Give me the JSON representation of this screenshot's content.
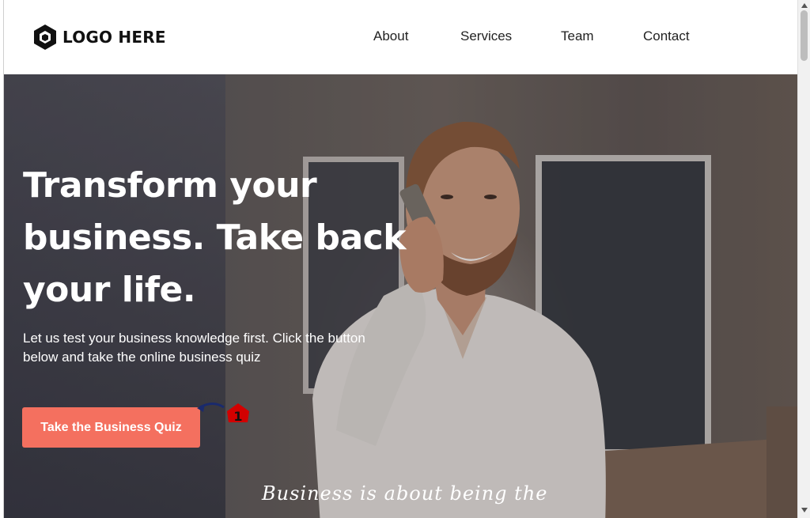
{
  "header": {
    "logo_text": "LOGO HERE",
    "logo_icon": "hexagon-cube-icon",
    "nav": [
      {
        "label": "About"
      },
      {
        "label": "Services"
      },
      {
        "label": "Team"
      },
      {
        "label": "Contact"
      }
    ]
  },
  "hero": {
    "title_lines": [
      "Transform your",
      "business. Take back",
      "your life."
    ],
    "subtitle_lines": [
      "Let us test your business knowledge first. Click the button",
      "below and take the online business quiz"
    ],
    "cta_label": "Take the Business Quiz",
    "annotation_number": "1",
    "tagline": "Business is about being the"
  },
  "colors": {
    "cta": "#f4705f",
    "text_light": "#ffffff",
    "nav_text": "#222222",
    "annotation_badge": "#d20000",
    "annotation_arrow": "#1a2a6c"
  }
}
